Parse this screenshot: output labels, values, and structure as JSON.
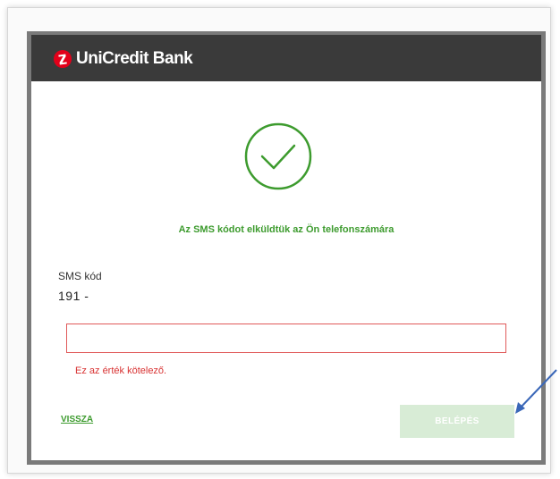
{
  "header": {
    "logo_text": "UniCredit Bank"
  },
  "status": {
    "icon": "checkmark-circle-icon",
    "message": "Az SMS kódot elküldtük az Ön telefonszámára"
  },
  "form": {
    "sms_label": "SMS kód",
    "sms_prefix": "191 -",
    "sms_input_value": "",
    "error_message": "Ez az érték kötelező."
  },
  "actions": {
    "back_label": "VISSZA",
    "login_label": "BELÉPÉS"
  },
  "colors": {
    "brand_red": "#e2001a",
    "success_green": "#3d9b2e",
    "error_red": "#d83232",
    "header_bg": "#3a3a3a",
    "disabled_button_bg": "#d8ecd6",
    "annotation_arrow": "#3a67b8"
  }
}
